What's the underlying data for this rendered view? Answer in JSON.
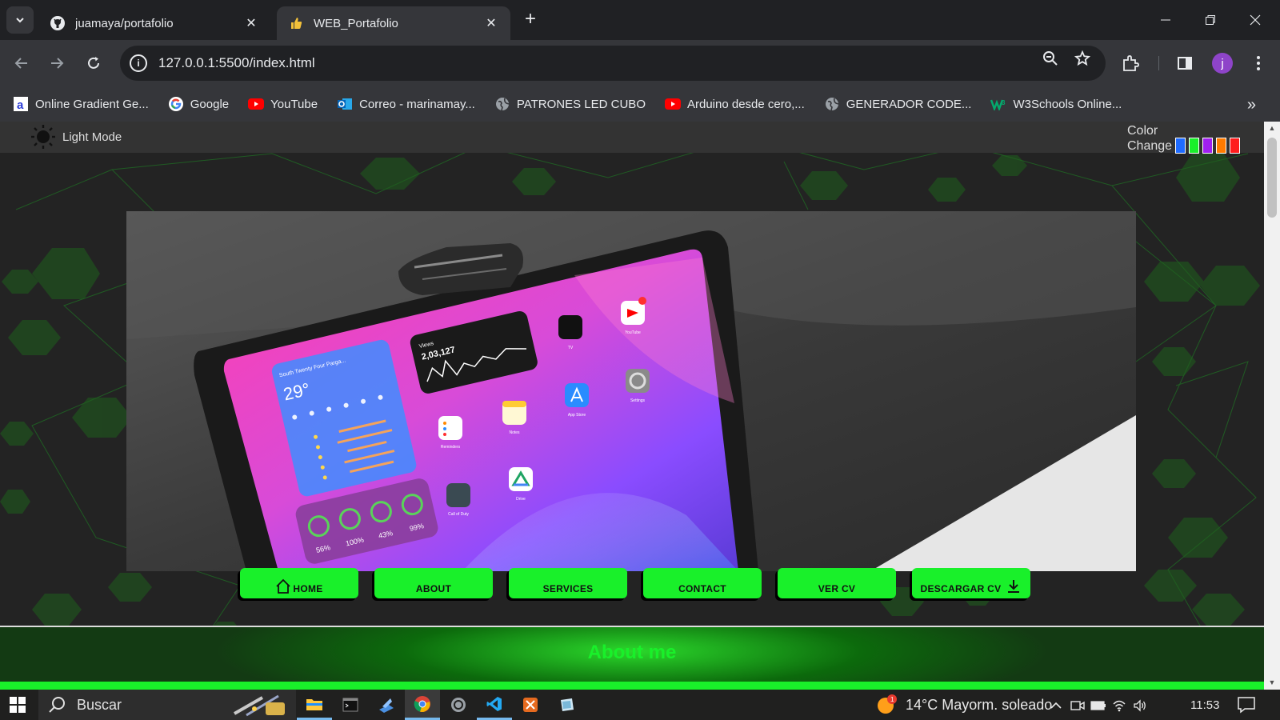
{
  "browser": {
    "tabs": [
      {
        "title": "juamaya/portafolio",
        "favicon": "github-icon",
        "active": false
      },
      {
        "title": "WEB_Portafolio",
        "favicon": "thumbs-up-icon",
        "active": true
      }
    ],
    "address": "127.0.0.1:5500/index.html",
    "profile_initial": "j",
    "bookmarks": [
      {
        "label": "Online Gradient Ge...",
        "icon": "gradient-a-icon"
      },
      {
        "label": "Google",
        "icon": "google-icon"
      },
      {
        "label": "YouTube",
        "icon": "youtube-icon"
      },
      {
        "label": "Correo - marinamay...",
        "icon": "outlook-icon"
      },
      {
        "label": "PATRONES LED CUBO",
        "icon": "globe-icon"
      },
      {
        "label": "Arduino desde cero,...",
        "icon": "youtube-icon"
      },
      {
        "label": "GENERADOR CODE...",
        "icon": "globe-icon"
      },
      {
        "label": "W3Schools Online...",
        "icon": "w3schools-icon"
      }
    ]
  },
  "page": {
    "mode_label": "Light Mode",
    "color_change_label_1": "Color",
    "color_change_label_2": "Change",
    "swatches": [
      "#1f6bff",
      "#19f02a",
      "#a020f0",
      "#ff7b00",
      "#ff1c1c"
    ],
    "nav": [
      {
        "label": "HOME",
        "icon": "home-icon"
      },
      {
        "label": "ABOUT"
      },
      {
        "label": "SERVICES"
      },
      {
        "label": "CONTACT"
      },
      {
        "label": "VER CV"
      },
      {
        "label": "DESCARGAR CV",
        "icon": "download-icon"
      }
    ],
    "about_title": "About me",
    "accent": "#19f02a"
  },
  "hero_image": {
    "widget_location": "South Twenty Four Parga...",
    "widget_temp": "29°",
    "views_label": "Views",
    "views_value": "2,03,127",
    "battery_levels": [
      "56%",
      "100%",
      "43%",
      "99%"
    ],
    "apps": [
      "TV",
      "YouTube",
      "App Store",
      "Settings",
      "Notes",
      "Reminders",
      "Drive",
      "Call of Duty"
    ]
  },
  "taskbar": {
    "search_label": "Buscar",
    "weather": "14°C  Mayorm. soleado",
    "time": "11:53"
  }
}
